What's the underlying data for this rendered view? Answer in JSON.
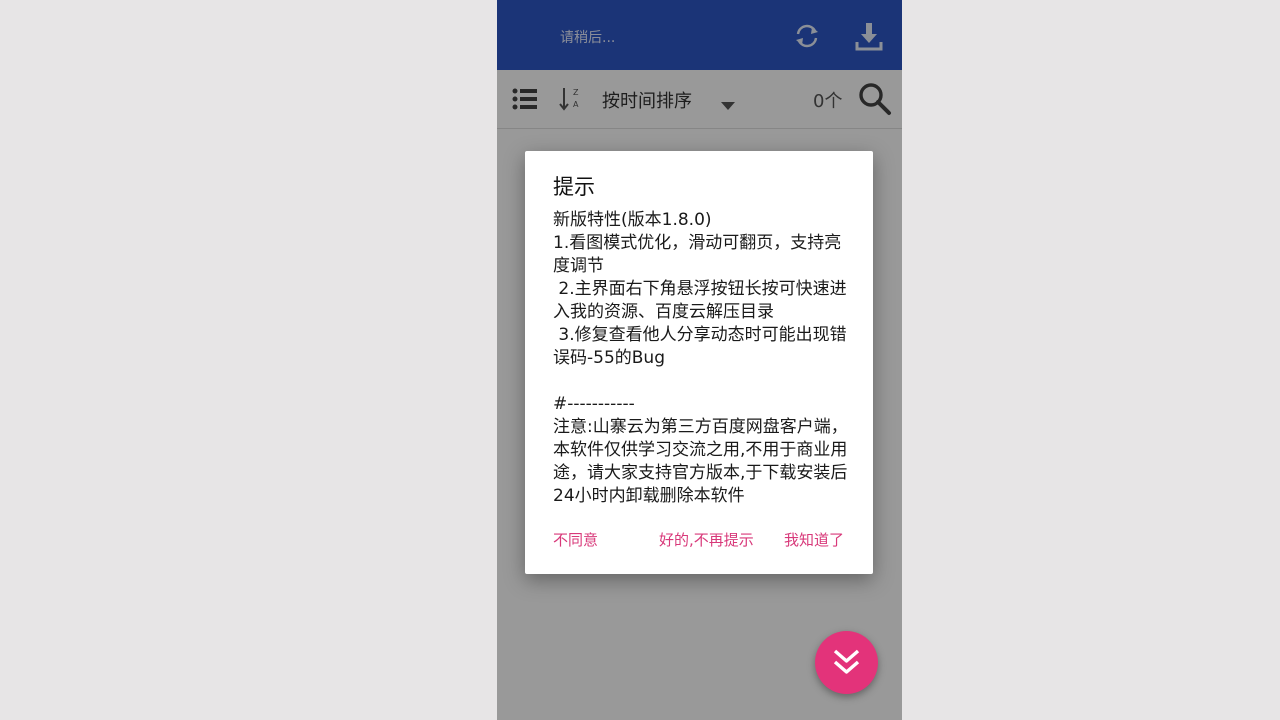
{
  "appbar": {
    "status_text": "请稍后...",
    "refresh_icon": "refresh-icon",
    "download_icon": "download-icon",
    "color": "#2d58c7"
  },
  "toolbar": {
    "list_icon": "list-icon",
    "sort_az_icon": "sort-az-icon",
    "sort_label": "按时间排序",
    "count": "0个",
    "search_icon": "search-icon"
  },
  "dialog": {
    "title": "提示",
    "body_lines": [
      "新版特性(版本1.8.0)",
      "1.看图模式优化，滑动可翻页，支持亮度调节",
      " 2.主界面右下角悬浮按钮长按可快速进入我的资源、百度云解压目录",
      " 3.修复查看他人分享动态时可能出现错误码-55的Bug",
      "",
      "#-----------",
      "注意:山寨云为第三方百度网盘客户端，本软件仅供学习交流之用,不用于商业用途，请大家支持官方版本,于下载安装后24小时内卸载删除本软件"
    ],
    "buttons": {
      "disagree": "不同意",
      "ok_no_remind": "好的,不再提示",
      "got_it": "我知道了"
    },
    "accent_color": "#d8397a"
  },
  "fab": {
    "icon": "double-chevron-down-icon",
    "color": "#e3337a"
  }
}
